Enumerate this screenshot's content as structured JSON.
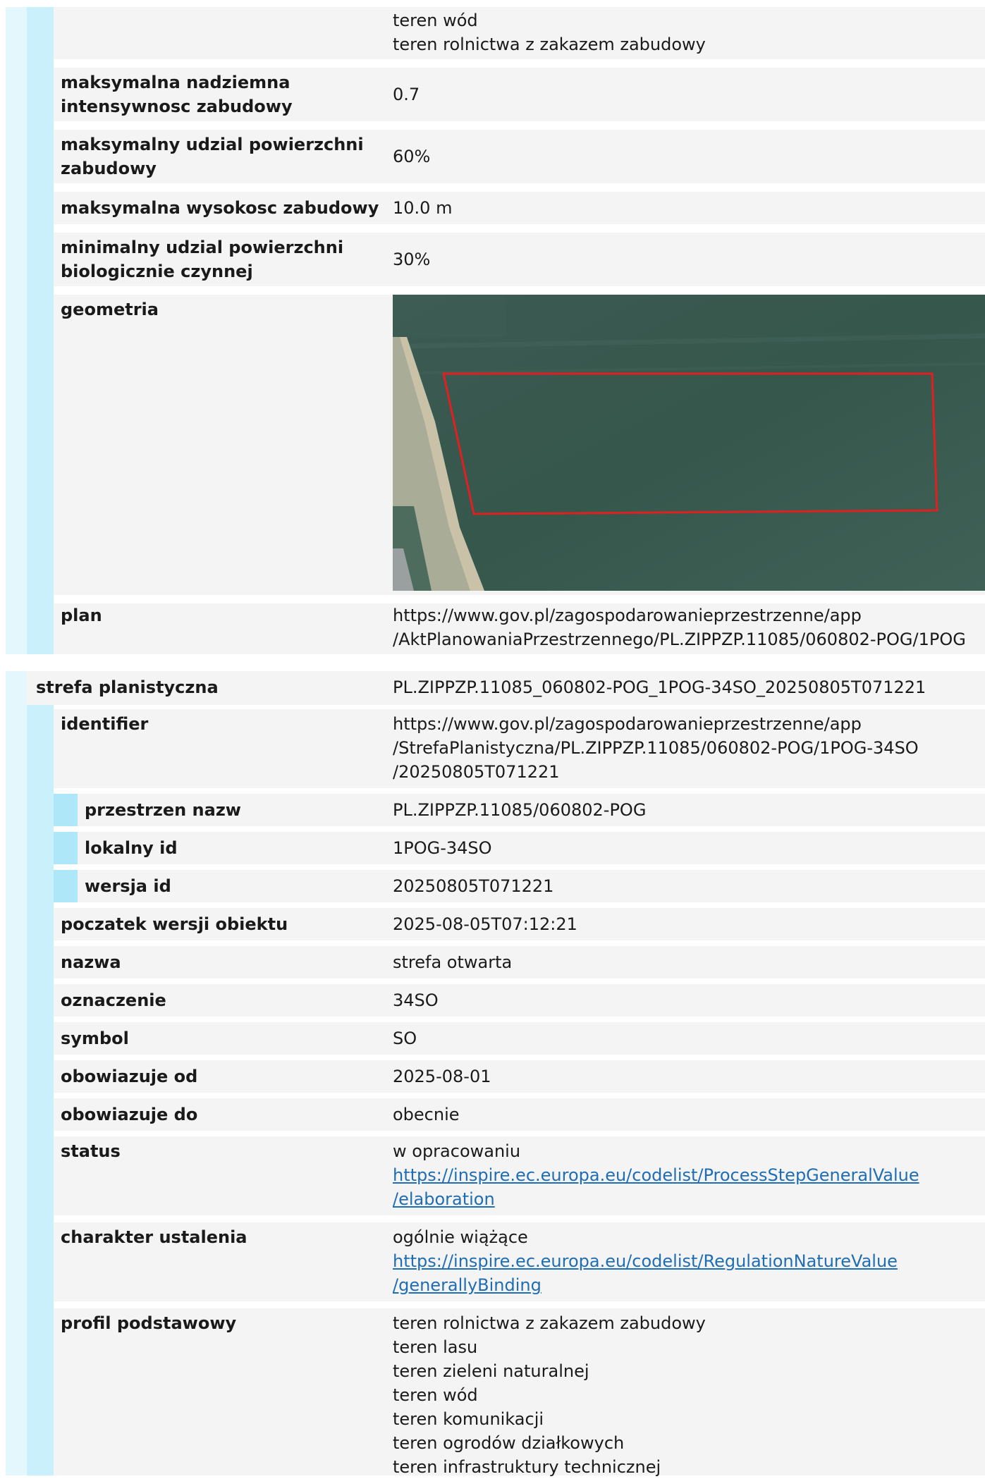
{
  "section1": {
    "top_values": [
      "teren wód",
      "teren rolnictwa z zakazem zabudowy"
    ],
    "rows": [
      {
        "label_lines": [
          "maksymalna nadziemna",
          "intensywnosc zabudowy"
        ],
        "value": "0.7"
      },
      {
        "label_lines": [
          "maksymalny udzial powierzchni",
          "zabudowy"
        ],
        "value": "60%"
      },
      {
        "label_lines": [
          "maksymalna wysokosc zabudowy"
        ],
        "value": "10.0 m"
      },
      {
        "label_lines": [
          "minimalny udzial powierzchni",
          "biologicznie czynnej"
        ],
        "value": "30%"
      }
    ],
    "geometry_label": "geometria",
    "plan_label": "plan",
    "plan_value_lines": [
      "https://www.gov.pl/zagospodarowanieprzestrzenne/app",
      "/AktPlanowaniaPrzestrzennego/PL.ZIPPZP.11085/060802-POG/1POG"
    ]
  },
  "section2": {
    "header_label": "strefa planistyczna",
    "header_value": "PL.ZIPPZP.11085_060802-POG_1POG-34SO_20250805T071221",
    "identifier_label": "identifier",
    "identifier_value_lines": [
      "https://www.gov.pl/zagospodarowanieprzestrzenne/app",
      "/StrefaPlanistyczna/PL.ZIPPZP.11085/060802-POG/1POG-34SO",
      "/20250805T071221"
    ],
    "identifier_sub": [
      {
        "label": "przestrzen nazw",
        "value": "PL.ZIPPZP.11085/060802-POG"
      },
      {
        "label": "lokalny id",
        "value": "1POG-34SO"
      },
      {
        "label": "wersja id",
        "value": "20250805T071221"
      }
    ],
    "simple_rows": [
      {
        "label": "poczatek wersji obiektu",
        "value": "2025-08-05T07:12:21"
      },
      {
        "label": "nazwa",
        "value": "strefa otwarta"
      },
      {
        "label": "oznaczenie",
        "value": "34SO"
      },
      {
        "label": "symbol",
        "value": "SO"
      },
      {
        "label": "obowiazuje od",
        "value": "2025-08-01"
      },
      {
        "label": "obowiazuje do",
        "value": "obecnie"
      }
    ],
    "status": {
      "label": "status",
      "value": "w opracowaniu",
      "link_lines": [
        "https://inspire.ec.europa.eu/codelist/ProcessStepGeneralValue",
        "/elaboration"
      ]
    },
    "charakter": {
      "label": "charakter ustalenia",
      "value": "ogólnie wiążące",
      "link_lines": [
        "https://inspire.ec.europa.eu/codelist/RegulationNatureValue",
        "/generallyBinding"
      ]
    },
    "profil": {
      "label": "profil podstawowy",
      "values": [
        "teren rolnictwa z zakazem zabudowy",
        "teren lasu",
        "teren zieleni naturalnej",
        "teren wód",
        "teren komunikacji",
        "teren ogrodów działkowych",
        "teren infrastruktury technicznej"
      ]
    }
  },
  "colors": {
    "row_bg": "#f4f4f4",
    "rail_light": "#e3f7fd",
    "rail_mid": "#c9f0fb",
    "rail_dark": "#aee8f8",
    "link": "#1f6db3",
    "geometry_outline": "#e02020"
  }
}
